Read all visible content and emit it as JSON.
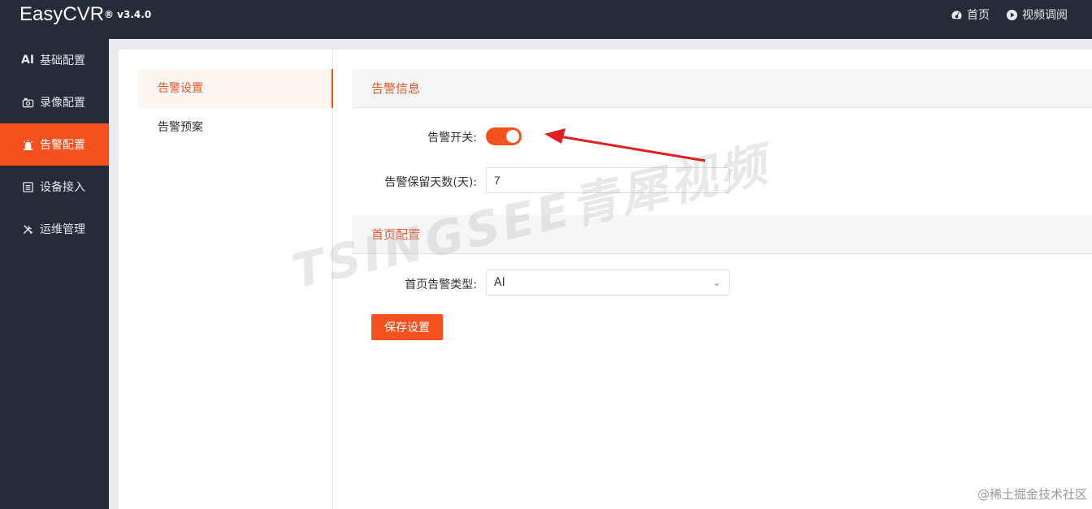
{
  "app": {
    "title": "EasyCVR",
    "version": "® v3.4.0"
  },
  "top_nav": [
    {
      "label": "首页",
      "icon": "dashboard-icon"
    },
    {
      "label": "视频调阅",
      "icon": "play-circle-icon"
    }
  ],
  "sidebar": {
    "items": [
      {
        "label": "基础配置",
        "icon": "ai-icon",
        "icon_text": "AI"
      },
      {
        "label": "录像配置",
        "icon": "camera-icon"
      },
      {
        "label": "告警配置",
        "icon": "alarm-icon"
      },
      {
        "label": "设备接入",
        "icon": "device-list-icon"
      },
      {
        "label": "运维管理",
        "icon": "tools-icon"
      }
    ],
    "active_index": 2
  },
  "subnav": {
    "items": [
      {
        "label": "告警设置"
      },
      {
        "label": "告警预案"
      }
    ],
    "active_index": 0
  },
  "sections": {
    "alarm_info": {
      "title": "告警信息",
      "switch_label": "告警开关:",
      "switch_on": true,
      "retention_label": "告警保留天数(天):",
      "retention_value": "7"
    },
    "home_config": {
      "title": "首页配置",
      "alarm_type_label": "首页告警类型:",
      "alarm_type_value": "AI"
    }
  },
  "save_button": "保存设置",
  "watermark": "TSINGSEE青犀视频",
  "credit": "@稀土掘金技术社区",
  "colors": {
    "accent": "#f4511e",
    "sidebar_bg": "#252b39",
    "arrow": "#e02020"
  }
}
